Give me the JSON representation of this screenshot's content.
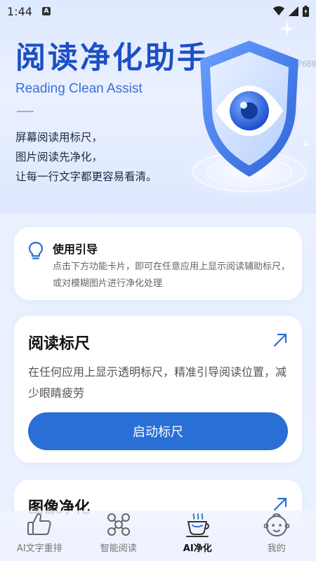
{
  "status_bar": {
    "time": "1:44",
    "notification_icon": "a-icon",
    "wifi_icon": "wifi-icon",
    "signal_icon": "signal-icon",
    "battery_icon": "battery-icon"
  },
  "hero": {
    "title": "阅读净化助手",
    "subtitle": "Reading Clean Assist",
    "desc_lines": [
      "屏幕阅读用标尺，",
      "图片阅读先净化，",
      "让每一行文字都更容易看清。"
    ],
    "id_text": "ID:b07689",
    "art_icon": "shield-eye-icon"
  },
  "guide": {
    "icon": "lightbulb-icon",
    "title": "使用引导",
    "text": "点击下方功能卡片，即可在任意应用上显示阅读辅助标尺，或对模糊图片进行净化处理"
  },
  "ruler_card": {
    "title": "阅读标尺",
    "desc": "在任何应用上显示透明标尺，精准引导阅读位置，减少眼睛疲劳",
    "button_label": "启动标尺"
  },
  "image_card": {
    "title": "图像净化"
  },
  "nav": {
    "items": [
      {
        "label": "AI文字重排",
        "icon": "thumbs-up-icon",
        "active": false
      },
      {
        "label": "智能阅读",
        "icon": "molecule-icon",
        "active": false
      },
      {
        "label": "AI净化",
        "icon": "cup-icon",
        "active": true
      },
      {
        "label": "我的",
        "icon": "baby-face-icon",
        "active": false
      }
    ]
  },
  "colors": {
    "accent": "#2a6fd6",
    "title_blue": "#1b4fc4",
    "background": "#eef3ff"
  }
}
